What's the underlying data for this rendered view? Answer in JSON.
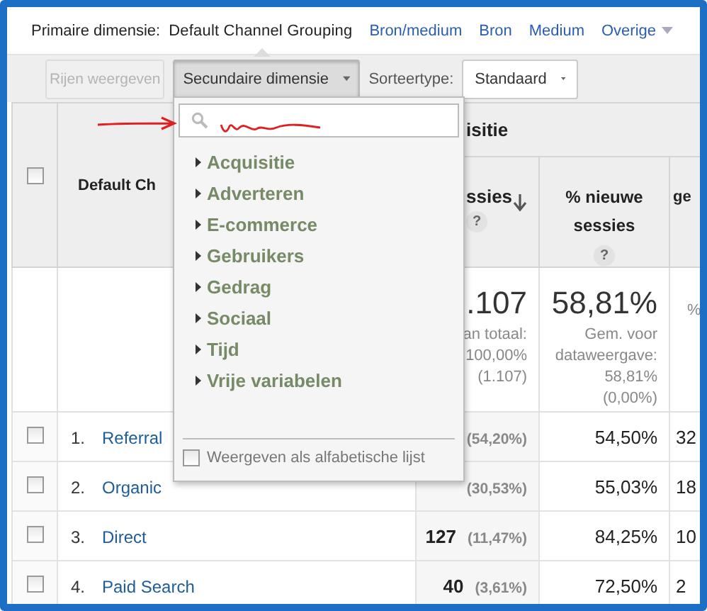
{
  "primary_dimension": {
    "label": "Primaire dimensie:",
    "options": [
      {
        "label": "Default Channel Grouping",
        "selected": true
      },
      {
        "label": "Bron/medium",
        "selected": false
      },
      {
        "label": "Bron",
        "selected": false
      },
      {
        "label": "Medium",
        "selected": false
      },
      {
        "label": "Overige",
        "selected": false,
        "kind": "menu"
      }
    ]
  },
  "toolbar": {
    "show_rows": {
      "label": "Rijen weergeven",
      "disabled": true
    },
    "secondary_dimension": {
      "label": "Secundaire dimensie",
      "expanded": true
    },
    "sort_label": "Sorteertype:",
    "sort_type": {
      "value": "Standaard"
    }
  },
  "table": {
    "select_all": {
      "checked": false
    },
    "dimension_header": "Default Ch",
    "group_header": "isitie",
    "columns": [
      {
        "label": "ssies",
        "help": "?",
        "sorted": true
      },
      {
        "label": "% nieuwe sessies",
        "help": "?",
        "sorted": false
      },
      {
        "label": "ge",
        "sorted": false
      }
    ],
    "totals": [
      {
        "value": ".107",
        "notes": [
          "an totaal:",
          "100,00%",
          "(1.107)"
        ]
      },
      {
        "value": "58,81%",
        "notes": [
          "Gem. voor",
          "dataweergave:",
          "58,81%",
          "(0,00%)"
        ]
      },
      {
        "notes": [
          "%"
        ]
      }
    ],
    "rows": [
      {
        "rank": "1.",
        "name": "Referral",
        "sessions_share": "(54,20%)",
        "new_sessions": "54,50%",
        "column_5": "32",
        "checked": false
      },
      {
        "rank": "2.",
        "name": "Organic",
        "sessions_share": "(30,53%)",
        "new_sessions": "55,03%",
        "column_5": "18",
        "checked": false
      },
      {
        "rank": "3.",
        "name": "Direct",
        "sessions": "127",
        "sessions_share": "(11,47%)",
        "new_sessions": "84,25%",
        "column_5": "10",
        "checked": false
      },
      {
        "rank": "4.",
        "name": "Paid Search",
        "sessions": "40",
        "sessions_share": "(3,61%)",
        "new_sessions": "72,50%",
        "column_5": "2",
        "checked": false
      }
    ]
  },
  "dropdown": {
    "categories": [
      {
        "label": "Acquisitie",
        "expanded": false
      },
      {
        "label": "Adverteren",
        "expanded": false
      },
      {
        "label": "E-commerce",
        "expanded": false
      },
      {
        "label": "Gebruikers",
        "expanded": false
      },
      {
        "label": "Gedrag",
        "expanded": false
      },
      {
        "label": "Sociaal",
        "expanded": false
      },
      {
        "label": "Tijd",
        "expanded": false
      },
      {
        "label": "Vrije variabelen",
        "expanded": false
      }
    ],
    "alphabetical": {
      "label": "Weergeven als alfabetische lijst",
      "checked": false
    }
  }
}
